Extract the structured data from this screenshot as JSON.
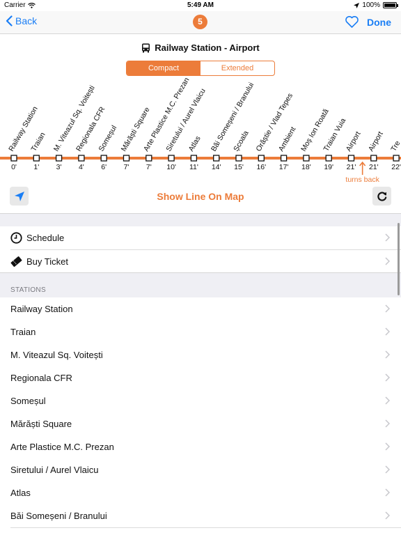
{
  "status_bar": {
    "carrier": "Carrier",
    "time": "5:49 AM",
    "battery": "100%"
  },
  "nav": {
    "back_label": "Back",
    "line_number": "5",
    "done_label": "Done"
  },
  "route": {
    "title": "Railway Station - Airport"
  },
  "segments": [
    {
      "label": "Compact",
      "selected": true
    },
    {
      "label": "Extended",
      "selected": false
    }
  ],
  "diagram": {
    "line_color": "#ec7c3a",
    "stops": [
      {
        "name": "Railway Station",
        "time": "0'"
      },
      {
        "name": "Traian",
        "time": "1'"
      },
      {
        "name": "M. Viteazul Sq. Voitești",
        "time": "3'"
      },
      {
        "name": "Regionala CFR",
        "time": "4'"
      },
      {
        "name": "Someșul",
        "time": "6'"
      },
      {
        "name": "Mărăști Square",
        "time": "7'"
      },
      {
        "name": "Arte Plastice M.C. Prezan",
        "time": "7'"
      },
      {
        "name": "Siretului / Aurel Vlaicu",
        "time": "10'"
      },
      {
        "name": "Atlas",
        "time": "11'"
      },
      {
        "name": "Băi Someșeni / Branului",
        "time": "14'"
      },
      {
        "name": "Școala",
        "time": "15'"
      },
      {
        "name": "Orăștie / Vlad Tepes",
        "time": "16'"
      },
      {
        "name": "Ambient",
        "time": "17'"
      },
      {
        "name": "Moș Ion Roată",
        "time": "18'"
      },
      {
        "name": "Traian Vuia",
        "time": "19'"
      },
      {
        "name": "Airport",
        "time": "21'"
      },
      {
        "name": "Airport",
        "time": "21'"
      },
      {
        "name": "Tre",
        "time": "22'"
      }
    ],
    "turns_back_label": "turns back"
  },
  "show_map_label": "Show Line On Map",
  "menu": {
    "schedule_label": "Schedule",
    "buy_ticket_label": "Buy Ticket"
  },
  "stations_header": "STATIONS",
  "stations": [
    "Railway Station",
    "Traian",
    "M. Viteazul Sq. Voitești",
    "Regionala CFR",
    "Someșul",
    "Mărăști Square",
    "Arte Plastice M.C. Prezan",
    "Siretului / Aurel Vlaicu",
    "Atlas",
    "Băi Someșeni / Branului"
  ]
}
